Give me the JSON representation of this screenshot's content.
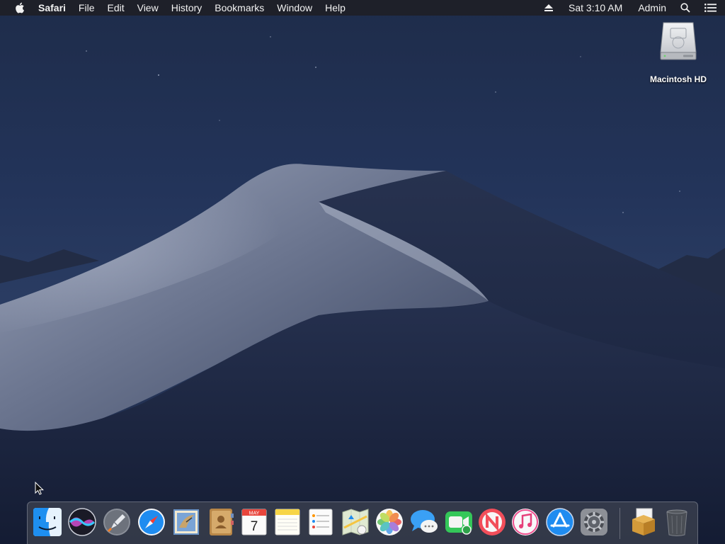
{
  "menubar": {
    "app_name": "Safari",
    "menus": [
      "File",
      "Edit",
      "View",
      "History",
      "Bookmarks",
      "Window",
      "Help"
    ],
    "clock": "Sat 3:10 AM",
    "user": "Admin"
  },
  "desktop": {
    "disk_label": "Macintosh HD"
  },
  "dock": {
    "items": [
      {
        "name": "Finder",
        "running": true
      },
      {
        "name": "Siri",
        "running": false
      },
      {
        "name": "Launchpad",
        "running": false
      },
      {
        "name": "Safari",
        "running": true
      },
      {
        "name": "Mail",
        "running": false
      },
      {
        "name": "Contacts",
        "running": false
      },
      {
        "name": "Calendar",
        "running": false,
        "month": "MAY",
        "day": "7"
      },
      {
        "name": "Notes",
        "running": false
      },
      {
        "name": "Reminders",
        "running": false
      },
      {
        "name": "Maps",
        "running": false
      },
      {
        "name": "Photos",
        "running": false
      },
      {
        "name": "Messages",
        "running": false
      },
      {
        "name": "FaceTime",
        "running": false
      },
      {
        "name": "News",
        "running": false
      },
      {
        "name": "iTunes",
        "running": false
      },
      {
        "name": "App Store",
        "running": false
      },
      {
        "name": "System Preferences",
        "running": false
      },
      {
        "name": "Downloads",
        "running": false
      },
      {
        "name": "Trash",
        "running": false
      }
    ]
  },
  "colors": {
    "menubar_bg": "#1e2026",
    "sky_top": "#1e2c4c",
    "dune_light": "#8e97ad"
  }
}
